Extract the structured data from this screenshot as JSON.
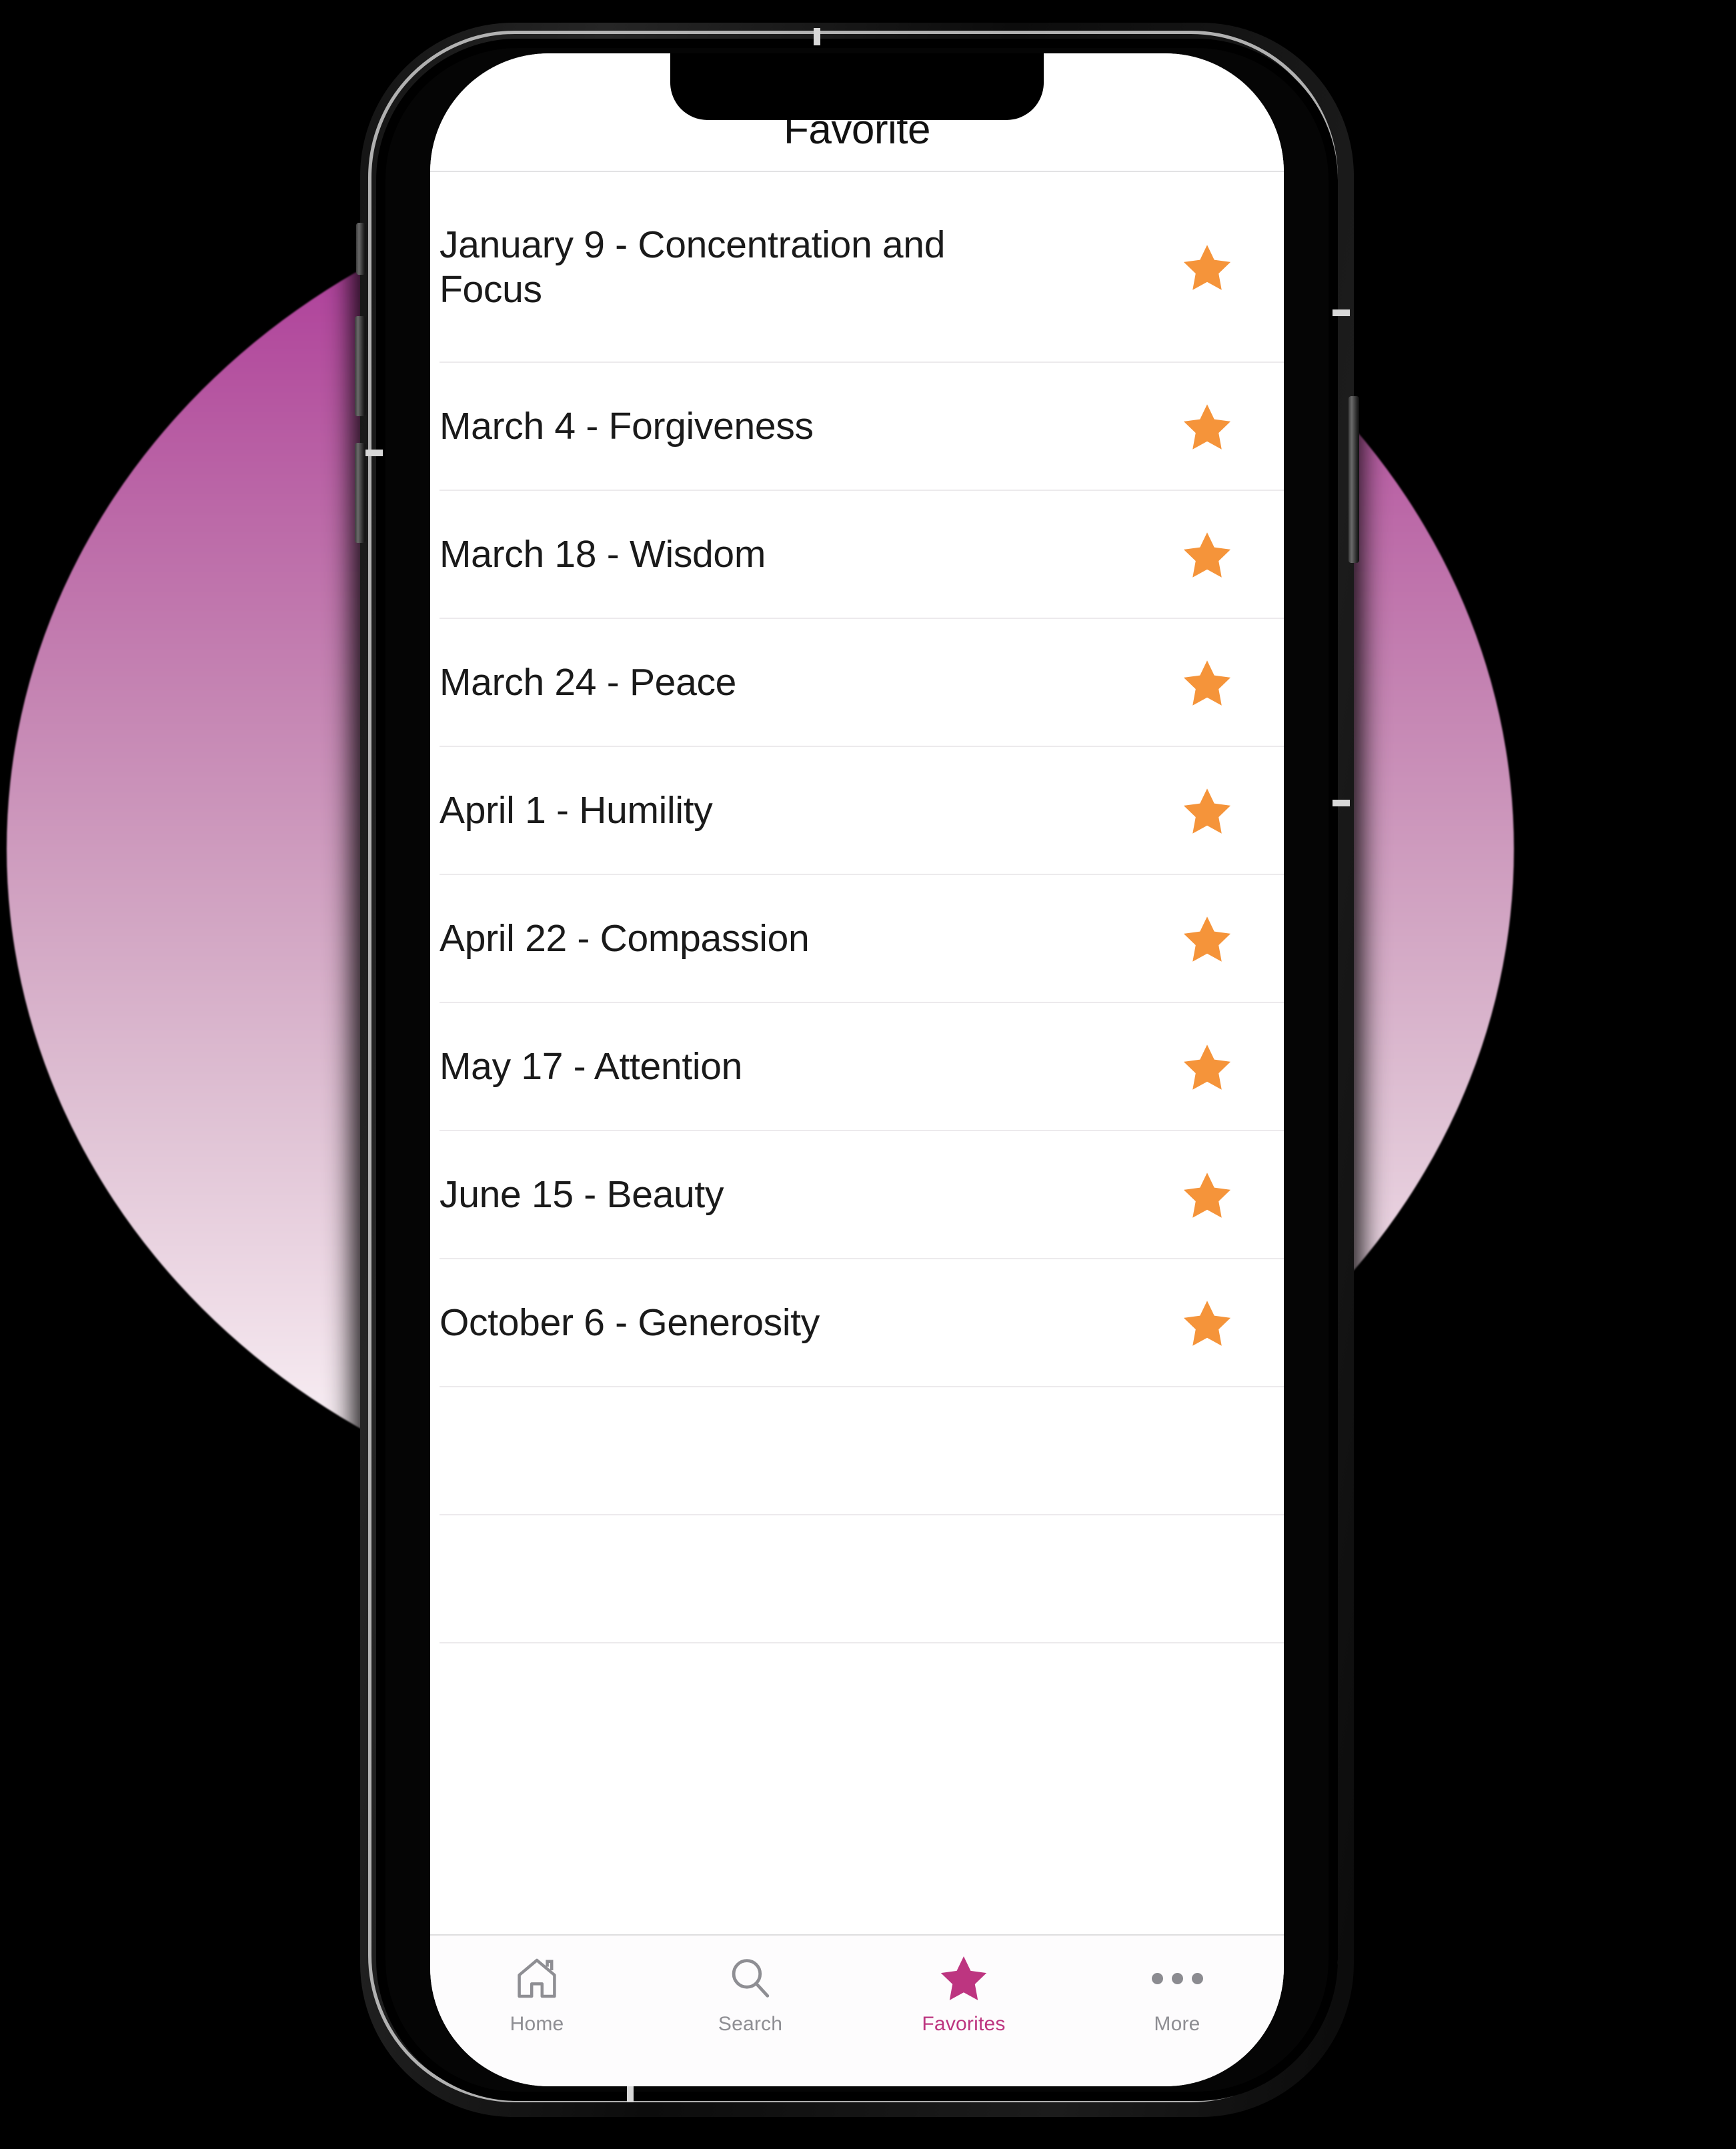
{
  "header": {
    "title": "Favorite"
  },
  "list": {
    "items": [
      {
        "label": "January 9 - Concentration and Focus",
        "starred": true,
        "star_icon": "star-filled-icon"
      },
      {
        "label": "March 4 - Forgiveness",
        "starred": true,
        "star_icon": "star-filled-icon"
      },
      {
        "label": "March 18 - Wisdom",
        "starred": true,
        "star_icon": "star-filled-icon"
      },
      {
        "label": "March 24 - Peace",
        "starred": true,
        "star_icon": "star-filled-icon"
      },
      {
        "label": "April 1 - Humility",
        "starred": true,
        "star_icon": "star-filled-icon"
      },
      {
        "label": "April 22 - Compassion",
        "starred": true,
        "star_icon": "star-filled-icon"
      },
      {
        "label": "May 17 - Attention",
        "starred": true,
        "star_icon": "star-filled-icon"
      },
      {
        "label": "June 15 - Beauty",
        "starred": true,
        "star_icon": "star-filled-icon"
      },
      {
        "label": "October 6 - Generosity",
        "starred": true,
        "star_icon": "star-filled-icon"
      }
    ],
    "empty_row_count": 2
  },
  "tab_bar": {
    "active": "Favorites",
    "tabs": [
      {
        "label": "Home",
        "icon": "house-icon",
        "active": false
      },
      {
        "label": "Search",
        "icon": "magnifier-icon",
        "active": false
      },
      {
        "label": "Favorites",
        "icon": "star-filled-icon",
        "active": true
      },
      {
        "label": "More",
        "icon": "ellipsis-icon",
        "active": false
      }
    ]
  },
  "colors": {
    "star_orange": "#F5943A",
    "accent_pink": "#BD3580",
    "tab_inactive": "#8E8E93",
    "separator": "#ECEAEC",
    "screen_background": "#FFFFFF",
    "page_background": "#000000",
    "gradient_top": "#A43096",
    "gradient_bottom": "#FFFFFF"
  }
}
